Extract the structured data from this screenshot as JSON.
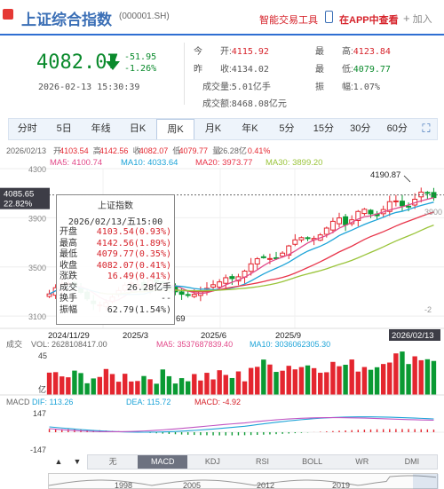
{
  "header": {
    "title": "上证综合指数",
    "code": "(000001.SH)",
    "tool": "智能交易工具",
    "app": "在APP中查看",
    "add": "加入",
    "add_plus": "+"
  },
  "quote": {
    "price": "4082.07",
    "change": "-51.95",
    "change_pct": "-1.26%",
    "datetime": "2026-02-13 15:30:39",
    "open_label": "今　　开:",
    "open": "4115.92",
    "prev_label": "昨　　收:",
    "prev": "4134.02",
    "vol_label": "成交量:",
    "vol": "5.01亿手",
    "amt_label": "成交额:",
    "amt": "8468.08亿元",
    "high_label": "最　　高:",
    "high": "4123.84",
    "low_label": "最　　低:",
    "low": "4079.77",
    "amp_label": "振　　幅:",
    "amp": "1.07%",
    "colors": {
      "up": "#d6232b",
      "down": "#0a8a2c"
    }
  },
  "tabs": [
    "分时",
    "5日",
    "年线",
    "日K",
    "周K",
    "月K",
    "年K",
    "5分",
    "15分",
    "30分",
    "60分"
  ],
  "active_tab": "周K",
  "expand_icon": "fullscreen-icon",
  "ohlc_bar": {
    "date": "2026/02/13",
    "o_label": "开",
    "o": "4103.54",
    "h_label": "高",
    "h": "4142.56",
    "c_label": "收",
    "c": "4082.07",
    "l_label": "低",
    "l": "4079.77",
    "v_label": "量",
    "v": "26.28亿",
    "p": "0.41%"
  },
  "ma": {
    "ma5": "MA5: 4100.74",
    "ma10": "MA10: 4033.64",
    "ma20": "MA20: 3973.77",
    "ma30": "MA30: 3899.20",
    "colors": {
      "ma5": "#e24a8a",
      "ma10": "#1ea4d8",
      "ma20": "#e8354a",
      "ma30": "#9ac43a"
    }
  },
  "price_axis": [
    "4300",
    "3900",
    "3500",
    "3100"
  ],
  "price_axis_right_partial": [
    "3900",
    "-2"
  ],
  "last_label": {
    "price": "4085.65",
    "pct": "22.82%"
  },
  "max_label": "4190.87",
  "min_label": "69",
  "date_axis": [
    "2024/11/29",
    "2025/3",
    "2025/6",
    "2025/9",
    "2026/02/13"
  ],
  "vol_bar": {
    "label": "成交",
    "vol": "VOL: 2628108417.00",
    "ma5": "MA5: 3537687839.40",
    "ma10": "MA10: 3036062305.30"
  },
  "vol_axis": [
    "45",
    "亿"
  ],
  "macd_bar": {
    "label": "MACD",
    "dif": "DIF: 113.26",
    "dea": "DEA: 115.72",
    "macd": "MACD: -4.92"
  },
  "macd_axis": [
    "147",
    "-147"
  ],
  "tooltip": {
    "title": "上证指数",
    "date": "2026/02/13/五15:00",
    "rows": [
      {
        "label": "开盘",
        "value": "4103.54(0.93%)",
        "color": "red"
      },
      {
        "label": "最高",
        "value": "4142.56(1.89%)",
        "color": "red"
      },
      {
        "label": "最低",
        "value": "4079.77(0.35%)",
        "color": "red"
      },
      {
        "label": "收盘",
        "value": "4082.07(0.41%)",
        "color": "red"
      },
      {
        "label": "涨跌",
        "value": "16.49(0.41%)",
        "color": "red"
      },
      {
        "label": "成交",
        "value": "26.28亿手",
        "color": "blk"
      },
      {
        "label": "换手",
        "value": "--",
        "color": "blk"
      },
      {
        "label": "振幅",
        "value": "62.79(1.54%)",
        "color": "blk"
      }
    ]
  },
  "indicator_tabs": [
    "无",
    "MACD",
    "KDJ",
    "RSI",
    "BOLL",
    "WR",
    "DMI"
  ],
  "active_indicator": "MACD",
  "nav": {
    "up": "▲",
    "down": "▼"
  },
  "overview_years": [
    "1998",
    "2005",
    "2012",
    "2019"
  ],
  "chart_data": {
    "type": "candlestick",
    "period": "weekly",
    "x": [
      "2024/11/29",
      "2025/3",
      "2025/6",
      "2025/9",
      "2026/02/13"
    ],
    "ylim": [
      3000,
      4300
    ],
    "last_close": 4082.07,
    "high_marker": 4190.87
  }
}
